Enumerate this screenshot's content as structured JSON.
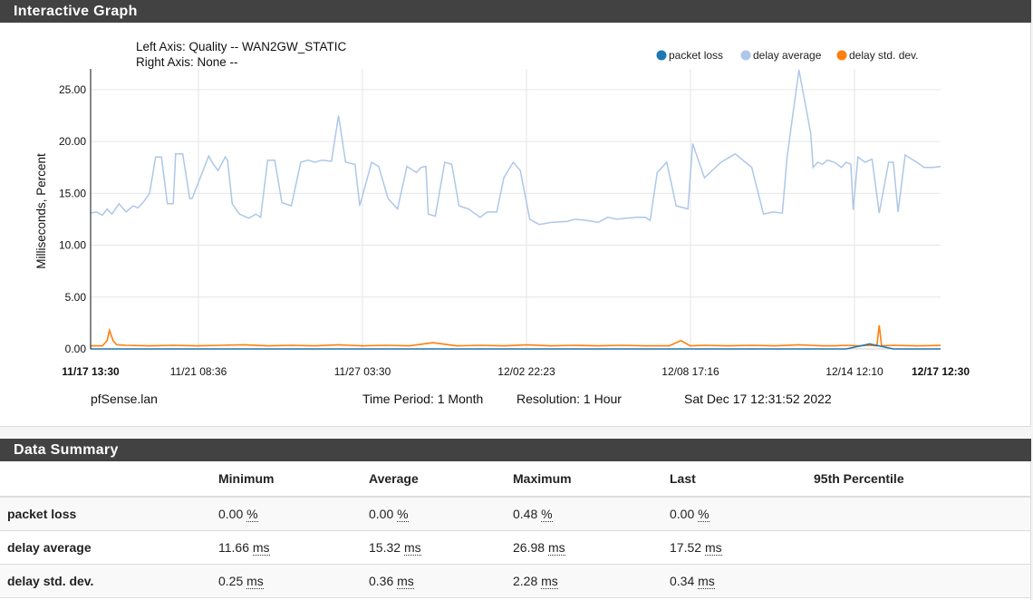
{
  "graph_panel": {
    "title": "Interactive Graph"
  },
  "summary_panel": {
    "title": "Data Summary"
  },
  "chart_data": {
    "type": "line",
    "title": "",
    "axis_info": {
      "left": "Left Axis: Quality -- WAN2GW_STATIC",
      "right": "Right Axis: None --"
    },
    "ylabel": "Milliseconds, Percent",
    "ylim": [
      0,
      27
    ],
    "yticks": [
      "0.00",
      "5.00",
      "10.00",
      "15.00",
      "20.00",
      "25.00"
    ],
    "xtick_labels": [
      "11/17 13:30",
      "11/21 08:36",
      "11/27 03:30",
      "12/02 22:23",
      "12/08 17:16",
      "12/14 12:10",
      "12/17 12:30"
    ],
    "grid": true,
    "legend_position": "top-right",
    "series": [
      {
        "name": "packet loss",
        "color": "#1f77b4",
        "x": [
          0,
          20,
          40,
          60,
          80,
          100,
          120,
          140,
          160,
          180,
          200,
          220,
          240,
          260,
          280,
          300,
          320,
          340,
          360,
          380,
          400,
          420,
          440,
          460,
          480,
          500,
          520,
          540,
          560,
          580,
          600,
          620,
          640,
          660,
          680,
          700,
          720
        ],
        "y": [
          0.0,
          0.0,
          0.0,
          0.0,
          0.0,
          0.0,
          0.0,
          0.0,
          0.0,
          0.0,
          0.0,
          0.0,
          0.0,
          0.0,
          0.0,
          0.0,
          0.0,
          0.0,
          0.0,
          0.0,
          0.0,
          0.0,
          0.0,
          0.0,
          0.0,
          0.0,
          0.0,
          0.0,
          0.0,
          0.0,
          0.0,
          0.0,
          0.0,
          0.48,
          0.0,
          0.0,
          0.0
        ]
      },
      {
        "name": "delay average",
        "color": "#aec7e8",
        "x": [
          0,
          5,
          10,
          14,
          18,
          24,
          30,
          36,
          40,
          45,
          50,
          55,
          60,
          65,
          70,
          72,
          78,
          84,
          86,
          100,
          104,
          108,
          114,
          116,
          120,
          126,
          134,
          140,
          144,
          150,
          156,
          162,
          170,
          178,
          184,
          190,
          196,
          204,
          210,
          216,
          224,
          228,
          238,
          244,
          252,
          260,
          268,
          276,
          280,
          284,
          286,
          292,
          300,
          306,
          312,
          320,
          330,
          336,
          344,
          350,
          358,
          364,
          372,
          380,
          390,
          404,
          410,
          420,
          430,
          438,
          446,
          454,
          462,
          470,
          474,
          480,
          488,
          496,
          506,
          510,
          520,
          534,
          546,
          560,
          570,
          578,
          586,
          590,
          600,
          610,
          612,
          616,
          620,
          624,
          630,
          636,
          640,
          644,
          646,
          650,
          656,
          662,
          668,
          676,
          680,
          684,
          690,
          694,
          700,
          706,
          714,
          720
        ],
        "y": [
          13.1,
          13.2,
          12.9,
          13.5,
          13.0,
          14.0,
          13.2,
          13.8,
          13.6,
          14.2,
          15.0,
          18.5,
          18.5,
          14.0,
          14.0,
          18.8,
          18.8,
          14.5,
          14.5,
          18.6,
          17.8,
          17.2,
          18.5,
          18.2,
          14.0,
          13.0,
          12.6,
          13.0,
          12.7,
          18.2,
          18.2,
          14.1,
          13.8,
          18.0,
          18.2,
          18.0,
          18.2,
          18.1,
          22.5,
          18.0,
          17.8,
          13.8,
          18.0,
          17.6,
          14.5,
          13.5,
          17.6,
          17.0,
          17.5,
          17.6,
          13.0,
          12.8,
          18.0,
          17.8,
          13.8,
          13.5,
          12.7,
          13.2,
          13.2,
          16.5,
          18.0,
          17.2,
          12.5,
          12.0,
          12.2,
          12.3,
          12.5,
          12.4,
          12.2,
          12.7,
          12.5,
          12.6,
          12.7,
          12.7,
          12.4,
          17.0,
          18.0,
          13.8,
          13.5,
          19.8,
          16.5,
          18.0,
          18.8,
          17.5,
          13.0,
          13.2,
          13.1,
          18.5,
          26.9,
          20.8,
          17.5,
          18.0,
          17.8,
          18.2,
          18.0,
          17.5,
          18.0,
          17.8,
          13.4,
          18.5,
          18.0,
          18.3,
          13.1,
          18.0,
          18.0,
          13.2,
          18.7,
          18.4,
          18.0,
          17.5,
          17.5,
          17.6
        ]
      },
      {
        "name": "delay std. dev.",
        "color": "#ff7f0e",
        "x": [
          0,
          10,
          14,
          16,
          19,
          22,
          30,
          50,
          70,
          90,
          110,
          130,
          150,
          170,
          190,
          210,
          230,
          250,
          270,
          290,
          310,
          330,
          350,
          370,
          390,
          410,
          430,
          450,
          470,
          490,
          500,
          508,
          520,
          540,
          560,
          580,
          600,
          610,
          620,
          630,
          640,
          650,
          660,
          666,
          668,
          670,
          680,
          700,
          720
        ],
        "y": [
          0.3,
          0.3,
          0.8,
          1.8,
          0.8,
          0.4,
          0.35,
          0.3,
          0.35,
          0.3,
          0.35,
          0.4,
          0.3,
          0.35,
          0.3,
          0.4,
          0.3,
          0.35,
          0.3,
          0.6,
          0.3,
          0.35,
          0.3,
          0.4,
          0.3,
          0.35,
          0.3,
          0.35,
          0.3,
          0.3,
          0.8,
          0.3,
          0.35,
          0.3,
          0.35,
          0.3,
          0.4,
          0.35,
          0.3,
          0.3,
          0.35,
          0.3,
          0.35,
          0.3,
          2.28,
          0.3,
          0.35,
          0.3,
          0.34
        ]
      }
    ]
  },
  "footer": {
    "host": "pfSense.lan",
    "time_period": "Time Period: 1 Month",
    "resolution": "Resolution: 1 Hour",
    "timestamp": "Sat Dec 17 12:31:52 2022"
  },
  "summary": {
    "columns": [
      "",
      "Minimum",
      "Average",
      "Maximum",
      "Last",
      "95th Percentile"
    ],
    "rows": [
      {
        "name": "packet loss",
        "min": "0.00",
        "avg": "0.00",
        "max": "0.48",
        "last": "0.00",
        "unit": "%"
      },
      {
        "name": "delay average",
        "min": "11.66",
        "avg": "15.32",
        "max": "26.98",
        "last": "17.52",
        "unit": "ms"
      },
      {
        "name": "delay std. dev.",
        "min": "0.25",
        "avg": "0.36",
        "max": "2.28",
        "last": "0.34",
        "unit": "ms"
      }
    ]
  }
}
